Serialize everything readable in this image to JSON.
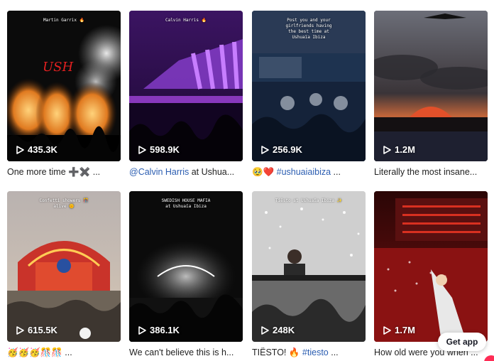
{
  "videos": [
    {
      "overlay": "Martin Garrix 🔥",
      "views": "435.3K",
      "caption_text": "One more time ➕✖️ ..."
    },
    {
      "overlay": "Calvin Harris 🔥",
      "views": "598.9K",
      "caption_tag": "@Calvin Harris",
      "caption_text": " at Ushua..."
    },
    {
      "overlay": "Post you and your\ngirlfriends having\nthe best time at\nUshuaïa Ibiza",
      "views": "256.9K",
      "caption_emoji": "🥹❤️",
      "caption_tag": " #ushuaiaibiza",
      "caption_text": " ..."
    },
    {
      "overlay": "",
      "views": "1.2M",
      "caption_text": "Literally the most insane..."
    },
    {
      "overlay": "Confetti showers 🎊\nalive 🌞",
      "views": "615.5K",
      "caption_emoji": "🥳🥳🥳🎊🎊",
      "caption_text": " ..."
    },
    {
      "overlay": "SWEDISH HOUSE MAFIA\nat Ushuaïa Ibiza",
      "views": "386.1K",
      "caption_text": "We can't believe this is h..."
    },
    {
      "overlay": "Tiësto at Ushuaïa Ibiza ✨",
      "views": "248K",
      "caption_text": "TIËSTO! 🔥",
      "caption_tag": " #tiesto",
      "caption_text2": " ..."
    },
    {
      "overlay": "",
      "views": "1.7M",
      "caption_text": "How old were you when ..."
    }
  ],
  "get_app_label": "Get app"
}
